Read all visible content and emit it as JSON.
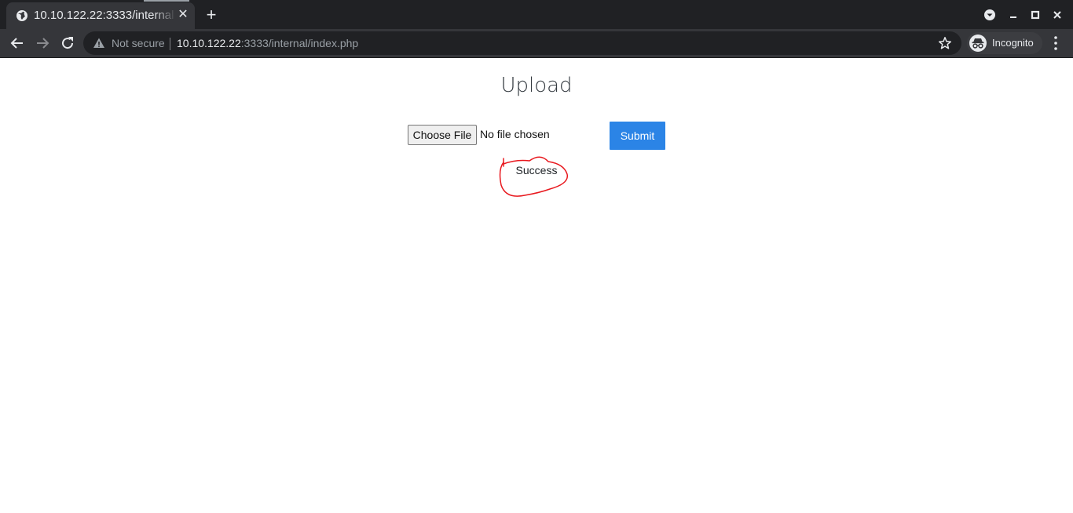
{
  "browser": {
    "tab": {
      "title": "10.10.122.22:3333/internal/index.php",
      "close_label": "✕"
    },
    "new_tab_label": "+",
    "toolbar": {
      "security_label": "Not secure",
      "url_host": "10.10.122.22",
      "url_path": ":3333/internal/index.php",
      "incognito_label": "Incognito"
    }
  },
  "page": {
    "title": "Upload",
    "file_input": {
      "button_label": "Choose File",
      "status": "No file chosen"
    },
    "submit_label": "Submit",
    "result": "Success"
  },
  "colors": {
    "submit_button": "#2b84e6",
    "annotation": "#e8181e",
    "tabstrip": "#202124",
    "toolbar": "#35363a"
  }
}
